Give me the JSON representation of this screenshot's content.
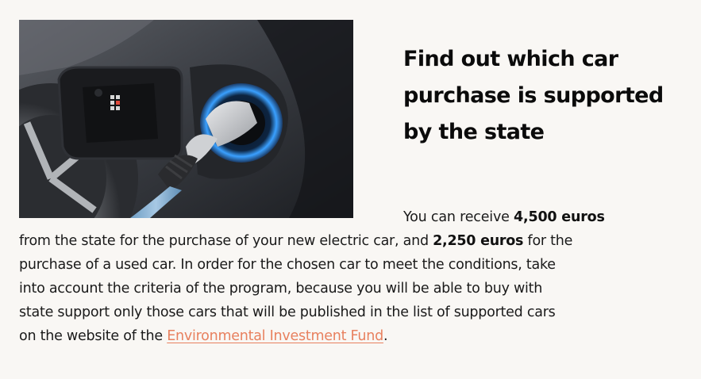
{
  "image": {
    "icon": "ev-charging-photo",
    "description_color": "#2d2f34"
  },
  "heading": "Find out which car purchase is supported by the state",
  "paragraph": {
    "intro": "You can receive ",
    "new_car_amount": "4,500 euros",
    "line2_a": "from the state for the purchase of your new electric car, and ",
    "used_car_amount": "2,250 euros",
    "line2_b": " for the",
    "line3": "purchase of a used car. In order for the chosen car to meet the conditions, take",
    "line4": "into account the criteria of the program, because you will be able to buy with",
    "line5": "state support only those cars that will be published in the list of supported cars",
    "line6_a": "on the website of the ",
    "link_text": "Environmental Investment Fund",
    "line6_b": "."
  },
  "colors": {
    "background": "#f9f7f4",
    "text": "#1a1a1a",
    "link": "#e8815f",
    "charger_glow": "#3aa0ff"
  }
}
